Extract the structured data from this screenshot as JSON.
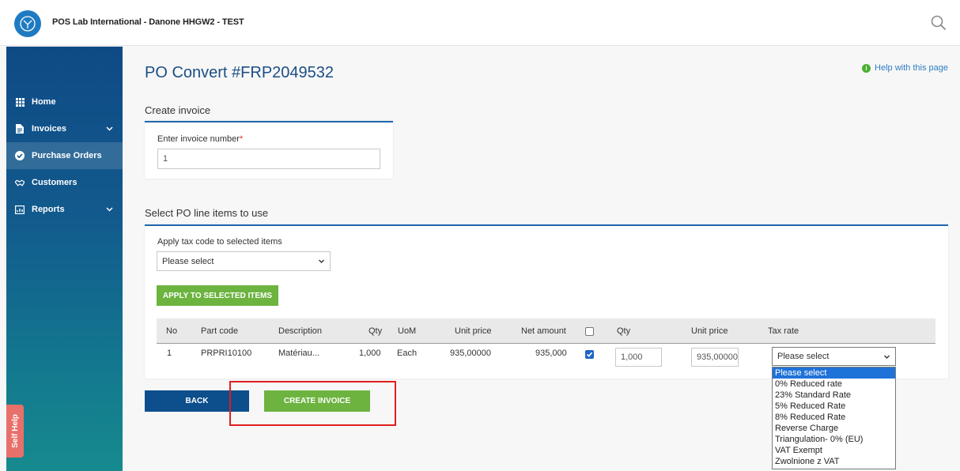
{
  "header": {
    "app_title": "POS Lab International - Danone HHGW2 - TEST"
  },
  "sidebar": {
    "items": [
      {
        "label": "Home",
        "icon": "grid-icon"
      },
      {
        "label": "Invoices",
        "icon": "document-icon"
      },
      {
        "label": "Purchase Orders",
        "icon": "check-circle-icon"
      },
      {
        "label": "Customers",
        "icon": "handshake-icon"
      },
      {
        "label": "Reports",
        "icon": "report-icon"
      }
    ],
    "active": "Purchase Orders",
    "self_help": "Self Help"
  },
  "page": {
    "title": "PO Convert #FRP2049532",
    "help_link": "Help with this page"
  },
  "create_invoice": {
    "section_title": "Create invoice",
    "invoice_number_label": "Enter invoice number",
    "required_mark": "*",
    "invoice_number_value": "1"
  },
  "line_items": {
    "section_title": "Select PO line items to use",
    "tax_code_label": "Apply tax code to selected items",
    "tax_code_value": "Please select",
    "apply_button": "APPLY TO SELECTED ITEMS",
    "columns": {
      "no": "No",
      "part_code": "Part code",
      "description": "Description",
      "qty": "Qty",
      "uom": "UoM",
      "unit_price": "Unit price",
      "net_amount": "Net amount",
      "qty2": "Qty",
      "unit_price2": "Unit price",
      "tax_rate": "Tax rate"
    },
    "row": {
      "no": "1",
      "part_code": "PRPRI10100",
      "description": "Matériau...",
      "qty": "1,000",
      "uom": "Each",
      "unit_price": "935,00000",
      "net_amount": "935,000",
      "selected": true,
      "qty_input": "1,000",
      "unit_price_input": "935,00000",
      "tax_rate_value": "Please select"
    },
    "tax_rate_options": [
      "Please select",
      "0% Reduced rate",
      "23% Standard Rate",
      "5% Reduced Rate",
      "8% Reduced Rate",
      "Reverse Charge",
      "Triangulation- 0% (EU)",
      "VAT Exempt",
      "Zwolnione z VAT"
    ]
  },
  "actions": {
    "back": "BACK",
    "create_invoice": "CREATE INVOICE"
  },
  "colors": {
    "primary_blue": "#0d4f8d",
    "accent_green": "#6cb33f",
    "highlight_red": "#e01e1e"
  }
}
